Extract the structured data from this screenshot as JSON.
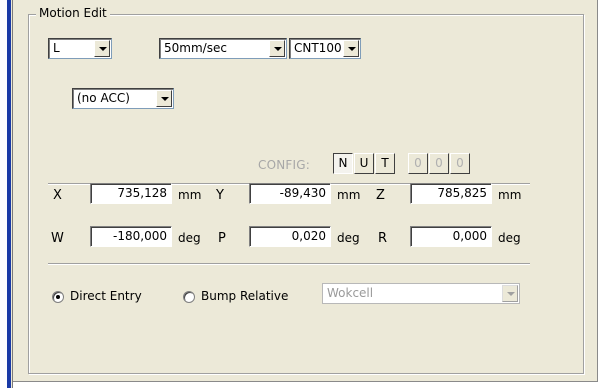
{
  "group": {
    "title": "Motion Edit"
  },
  "motion": {
    "type": "L",
    "speed": "50mm/sec",
    "termination": "CNT100",
    "acc": "(no ACC)"
  },
  "config": {
    "label": "CONFIG:",
    "buttons": [
      "N",
      "U",
      "T",
      "0",
      "0",
      "0"
    ]
  },
  "position": {
    "x": {
      "label": "X",
      "value": "735,128",
      "unit": "mm"
    },
    "y": {
      "label": "Y",
      "value": "-89,430",
      "unit": "mm"
    },
    "z": {
      "label": "Z",
      "value": "785,825",
      "unit": "mm"
    },
    "w": {
      "label": "W",
      "value": "-180,000",
      "unit": "deg"
    },
    "p": {
      "label": "P",
      "value": "0,020",
      "unit": "deg"
    },
    "r": {
      "label": "R",
      "value": "0,000",
      "unit": "deg"
    }
  },
  "entry": {
    "direct_label": "Direct Entry",
    "bump_label": "Bump Relative",
    "frame": "Wokcell"
  }
}
